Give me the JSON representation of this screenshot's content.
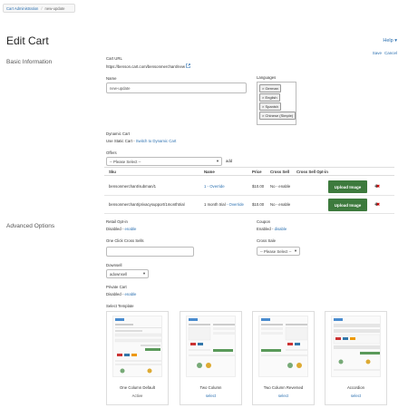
{
  "breadcrumb": {
    "root": "Cart Administration",
    "current": "new-update"
  },
  "page": {
    "title": "Edit Cart",
    "help": "Help ▾",
    "save": "Save",
    "cancel": "Cancel"
  },
  "basic": {
    "section_title": "Basic Information",
    "cart_url_label": "Cart URL",
    "cart_url": "https://benson.cart.com/bensonmerchant/new",
    "name_label": "Name",
    "name_value": "new-update",
    "languages_label": "Languages",
    "languages": [
      "× German",
      "× English",
      "× Spanish",
      "× Chinese (Simple)"
    ]
  },
  "dynamic_cart": {
    "label": "Dynamic Cart",
    "text": "Use Static Cart - ",
    "switch_link": "Switch to Dynamic Cart"
  },
  "offers": {
    "label": "Offers",
    "select_value": "-- Please Select --",
    "add_link": "add",
    "headers": [
      "Sku",
      "Name",
      "Price",
      "Cross Sell",
      "Cross Sell Opt-in"
    ],
    "rows": [
      {
        "sku": "bensonmerchant/subman/1",
        "name": "1 - Override",
        "price": "$10.00",
        "cross_sell": "No - enable",
        "upload": "Upload Image"
      },
      {
        "sku": "bensonmerchant/privacysupport/1monthtrial",
        "name": "1 month trial",
        "name_override": " - Override",
        "price": "$10.00",
        "cross_sell": "No - enable",
        "upload": "Upload Image"
      }
    ]
  },
  "advanced": {
    "section_title": "Advanced Options",
    "retail_optin_label": "Retail Opt-in",
    "retail_optin_value": "Disabled - ",
    "retail_optin_link": "enable",
    "coupon_label": "Coupon",
    "coupon_value": "Enabled - ",
    "coupon_link": "disable",
    "one_click_label": "One Click Cross Sells",
    "cross_sale_label": "Cross Sale",
    "cross_sale_select": "-- Please Select --",
    "downsell_label": "Downsell",
    "downsell_value": "adownsell",
    "private_cart_label": "Private Cart",
    "private_cart_value": "Disabled - ",
    "private_cart_link": "enable",
    "select_template_label": "Select Template"
  },
  "templates": [
    {
      "name": "One Column Default",
      "action": "Active"
    },
    {
      "name": "Two Column",
      "action": "select"
    },
    {
      "name": "Two Column Reversed",
      "action": "select"
    },
    {
      "name": "Accordion",
      "action": "select"
    }
  ]
}
